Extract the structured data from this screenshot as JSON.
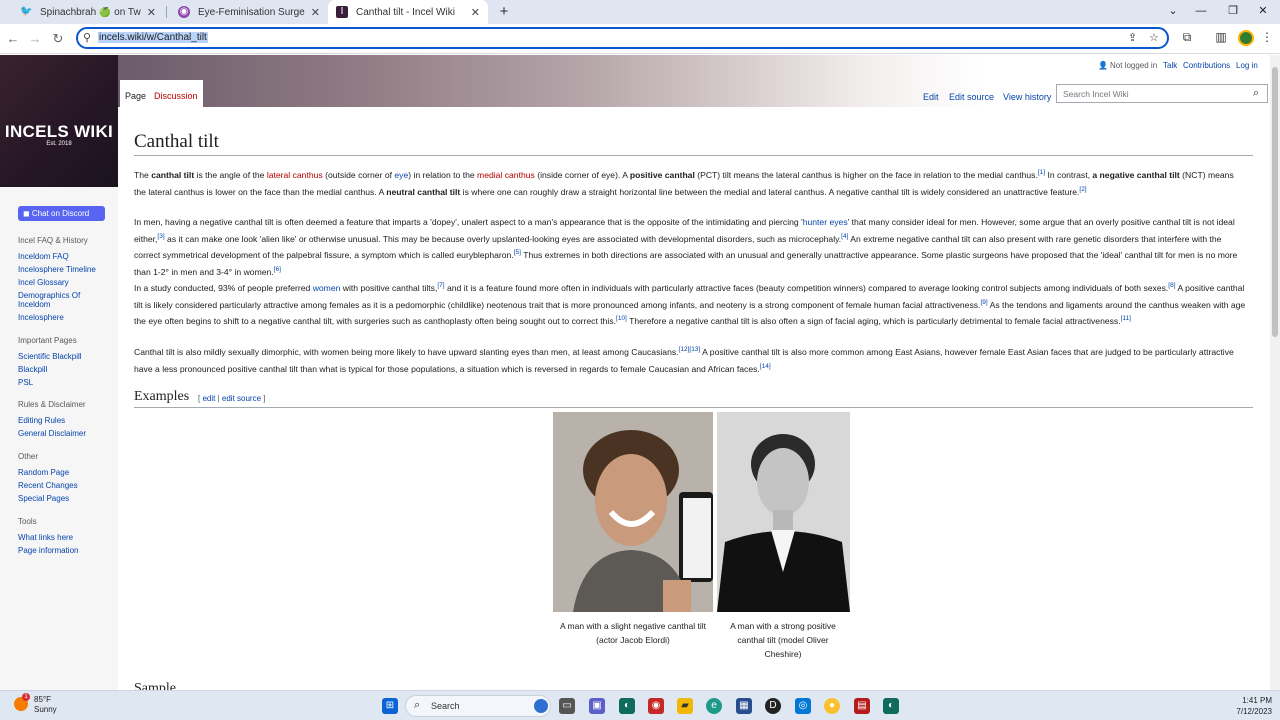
{
  "browser": {
    "tabs": [
      {
        "title": "Spinachbrah 🍏 on Twitter: \"Pe",
        "icon": "twitter-bird-icon"
      },
      {
        "title": "Eye-Feminisation Surgery: What",
        "icon": "site-favicon"
      },
      {
        "title": "Canthal tilt - Incel Wiki",
        "icon": "wiki-favicon"
      }
    ],
    "url": "incels.wiki/w/Canthal_tilt"
  },
  "wiki": {
    "logo_name": "INCELS WIKI",
    "logo_est": "Est. 2018",
    "discord_label": "Chat on Discord",
    "personal": {
      "not_logged": "Not logged in",
      "talk": "Talk",
      "contributions": "Contributions",
      "login": "Log in"
    },
    "ns_tabs": {
      "page": "Page",
      "discussion": "Discussion"
    },
    "view_tabs": {
      "edit": "Edit",
      "edit_source": "Edit source",
      "history": "View history"
    },
    "search_placeholder": "Search Incel Wiki",
    "sidebar": {
      "faq_head": "Incel FAQ & History",
      "faq": [
        "Inceldom FAQ",
        "Incelosphere Timeline",
        "Incel Glossary",
        "Demographics Of Inceldom",
        "Incelosphere"
      ],
      "important_head": "Important Pages",
      "important": [
        "Scientific Blackpill",
        "Blackpill",
        "PSL"
      ],
      "rules_head": "Rules & Disclaimer",
      "rules": [
        "Editing Rules",
        "General Disclaimer"
      ],
      "other_head": "Other",
      "other": [
        "Random Page",
        "Recent Changes",
        "Special Pages"
      ],
      "tools_head": "Tools",
      "tools": [
        "What links here",
        "Page information"
      ]
    }
  },
  "article": {
    "title": "Canthal tilt",
    "section_examples": "Examples",
    "edit": "edit",
    "edit_source": "edit source",
    "captions": {
      "left": "A man with a slight negative canthal tilt (actor Jacob Elordi)",
      "right": "A man with a strong positive canthal tilt (model Oliver Cheshire)"
    },
    "next_section_partial": "Sample"
  },
  "taskbar": {
    "temp": "85°F",
    "condition": "Sunny",
    "search_label": "Search",
    "time": "1:41 PM",
    "date": "7/12/2023"
  }
}
